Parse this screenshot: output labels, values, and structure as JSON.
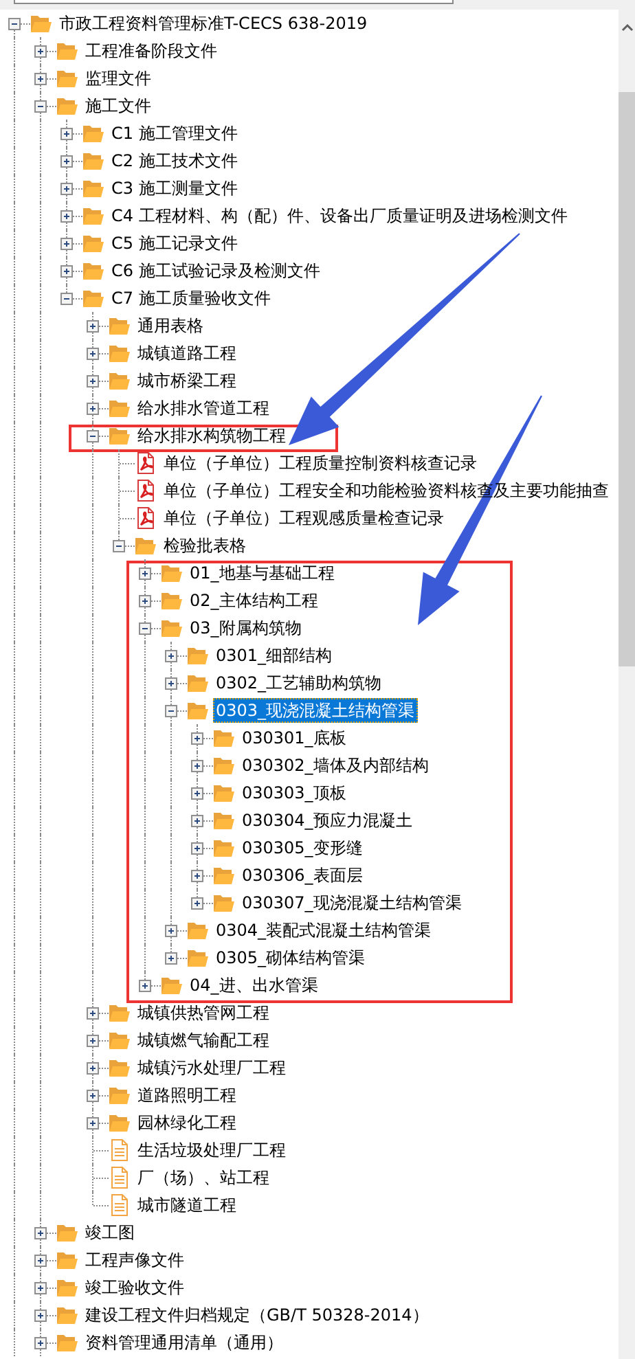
{
  "tree": [
    {
      "label": "市政工程资料管理标准T-CECS 638-2019",
      "kind": "folder",
      "expanded": true,
      "selected": false,
      "children": [
        {
          "label": "工程准备阶段文件",
          "kind": "folder",
          "expanded": false,
          "selected": false
        },
        {
          "label": "监理文件",
          "kind": "folder",
          "expanded": false,
          "selected": false
        },
        {
          "label": "施工文件",
          "kind": "folder",
          "expanded": true,
          "selected": false,
          "children": [
            {
              "label": "C1 施工管理文件",
              "kind": "folder",
              "expanded": false,
              "selected": false
            },
            {
              "label": "C2 施工技术文件",
              "kind": "folder",
              "expanded": false,
              "selected": false
            },
            {
              "label": "C3 施工测量文件",
              "kind": "folder",
              "expanded": false,
              "selected": false
            },
            {
              "label": "C4 工程材料、构（配）件、设备出厂质量证明及进场检测文件",
              "kind": "folder",
              "expanded": false,
              "selected": false
            },
            {
              "label": "C5 施工记录文件",
              "kind": "folder",
              "expanded": false,
              "selected": false
            },
            {
              "label": "C6 施工试验记录及检测文件",
              "kind": "folder",
              "expanded": false,
              "selected": false
            },
            {
              "label": "C7 施工质量验收文件",
              "kind": "folder",
              "expanded": true,
              "selected": false,
              "children": [
                {
                  "label": "通用表格",
                  "kind": "folder",
                  "expanded": false,
                  "selected": false
                },
                {
                  "label": "城镇道路工程",
                  "kind": "folder",
                  "expanded": false,
                  "selected": false
                },
                {
                  "label": "城市桥梁工程",
                  "kind": "folder",
                  "expanded": false,
                  "selected": false
                },
                {
                  "label": "给水排水管道工程",
                  "kind": "folder",
                  "expanded": false,
                  "selected": false
                },
                {
                  "label": "给水排水构筑物工程",
                  "kind": "folder",
                  "expanded": true,
                  "selected": false,
                  "marked": true,
                  "children": [
                    {
                      "label": "单位（子单位）工程质量控制资料核查记录",
                      "kind": "pdf",
                      "selected": false
                    },
                    {
                      "label": "单位（子单位）工程安全和功能检验资料核查及主要功能抽查",
                      "kind": "pdf",
                      "selected": false
                    },
                    {
                      "label": "单位（子单位）工程观感质量检查记录",
                      "kind": "pdf",
                      "selected": false
                    },
                    {
                      "label": "检验批表格",
                      "kind": "folder",
                      "expanded": true,
                      "selected": false,
                      "children_marked": true,
                      "children": [
                        {
                          "label": "01_地基与基础工程",
                          "kind": "folder",
                          "expanded": false,
                          "selected": false
                        },
                        {
                          "label": "02_主体结构工程",
                          "kind": "folder",
                          "expanded": false,
                          "selected": false
                        },
                        {
                          "label": "03_附属构筑物",
                          "kind": "folder",
                          "expanded": true,
                          "selected": false,
                          "children": [
                            {
                              "label": "0301_细部结构",
                              "kind": "folder",
                              "expanded": false,
                              "selected": false
                            },
                            {
                              "label": "0302_工艺辅助构筑物",
                              "kind": "folder",
                              "expanded": false,
                              "selected": false
                            },
                            {
                              "label": "0303_现浇混凝土结构管渠",
                              "kind": "folder",
                              "expanded": true,
                              "selected": true,
                              "children": [
                                {
                                  "label": "030301_底板",
                                  "kind": "folder",
                                  "expanded": false,
                                  "selected": false
                                },
                                {
                                  "label": "030302_墙体及内部结构",
                                  "kind": "folder",
                                  "expanded": false,
                                  "selected": false
                                },
                                {
                                  "label": "030303_顶板",
                                  "kind": "folder",
                                  "expanded": false,
                                  "selected": false
                                },
                                {
                                  "label": "030304_预应力混凝土",
                                  "kind": "folder",
                                  "expanded": false,
                                  "selected": false
                                },
                                {
                                  "label": "030305_变形缝",
                                  "kind": "folder",
                                  "expanded": false,
                                  "selected": false
                                },
                                {
                                  "label": "030306_表面层",
                                  "kind": "folder",
                                  "expanded": false,
                                  "selected": false
                                },
                                {
                                  "label": "030307_现浇混凝土结构管渠",
                                  "kind": "folder",
                                  "expanded": false,
                                  "selected": false
                                }
                              ]
                            },
                            {
                              "label": "0304_装配式混凝土结构管渠",
                              "kind": "folder",
                              "expanded": false,
                              "selected": false
                            },
                            {
                              "label": "0305_砌体结构管渠",
                              "kind": "folder",
                              "expanded": false,
                              "selected": false
                            }
                          ]
                        },
                        {
                          "label": "04_进、出水管渠",
                          "kind": "folder",
                          "expanded": false,
                          "selected": false
                        }
                      ]
                    }
                  ]
                },
                {
                  "label": "城镇供热管网工程",
                  "kind": "folder",
                  "expanded": false,
                  "selected": false
                },
                {
                  "label": "城镇燃气输配工程",
                  "kind": "folder",
                  "expanded": false,
                  "selected": false
                },
                {
                  "label": "城镇污水处理厂工程",
                  "kind": "folder",
                  "expanded": false,
                  "selected": false
                },
                {
                  "label": "道路照明工程",
                  "kind": "folder",
                  "expanded": false,
                  "selected": false
                },
                {
                  "label": "园林绿化工程",
                  "kind": "folder",
                  "expanded": false,
                  "selected": false
                },
                {
                  "label": "生活垃圾处理厂工程",
                  "kind": "doc",
                  "selected": false
                },
                {
                  "label": "厂（场）、站工程",
                  "kind": "doc",
                  "selected": false
                },
                {
                  "label": "城市隧道工程",
                  "kind": "doc",
                  "selected": false
                }
              ]
            }
          ]
        },
        {
          "label": "竣工图",
          "kind": "folder",
          "expanded": false,
          "selected": false
        },
        {
          "label": "工程声像文件",
          "kind": "folder",
          "expanded": false,
          "selected": false
        },
        {
          "label": "竣工验收文件",
          "kind": "folder",
          "expanded": false,
          "selected": false
        },
        {
          "label": "建设工程文件归档规定（GB/T 50328-2014）",
          "kind": "folder",
          "expanded": false,
          "selected": false
        },
        {
          "label": "资料管理通用清单（通用）",
          "kind": "folder",
          "expanded": false,
          "selected": false
        }
      ]
    }
  ]
}
